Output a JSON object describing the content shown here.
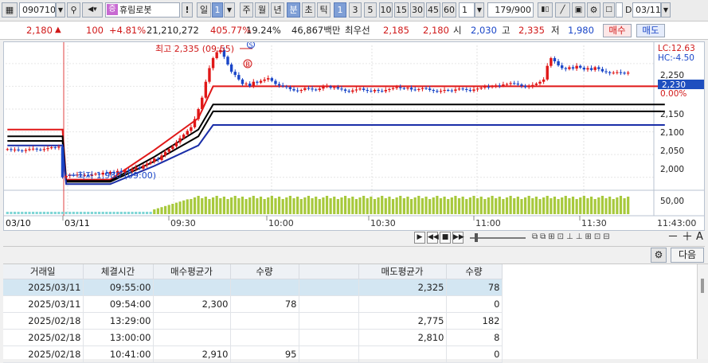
{
  "toolbar": {
    "stock_code": "090710",
    "stock_name": "휴림로봇",
    "exclaim": "!",
    "period_tabs": [
      "일",
      "1",
      "주",
      "월",
      "년",
      "분",
      "초",
      "틱"
    ],
    "active_period": "분",
    "intervals": [
      "1",
      "3",
      "5",
      "10",
      "15",
      "30",
      "45",
      "60"
    ],
    "active_interval": "1",
    "unit_value": "1",
    "count": "179/900",
    "checkbox_label": "D",
    "date": "03/11"
  },
  "quote": {
    "price": "2,180",
    "change": "100",
    "change_pct": "+4.81%",
    "volume": "21,210,272",
    "vol_ratio": "405.77%",
    "turnover": "19.24%",
    "amount": "46,867백만",
    "best_ask_label": "최우선",
    "best_ask": "2,185",
    "best_bid": "2,180",
    "open_label": "시",
    "open": "2,030",
    "high_label": "고",
    "high": "2,335",
    "low_label": "저",
    "low": "1,980",
    "buy_label": "매수",
    "sell_label": "매도"
  },
  "chart_data": {
    "type": "candlestick",
    "title": "",
    "x_tick_labels": [
      "03/10",
      "03/11",
      "09:30",
      "10:00",
      "10:30",
      "11:00",
      "11:30",
      "11:43:00"
    ],
    "y_tick_labels": [
      "2,250",
      "2,230",
      "0.00%",
      "2,150",
      "2,100",
      "2,050",
      "2,000"
    ],
    "volume_tick_label": "50,00",
    "ylim": [
      1975,
      2290
    ],
    "annotations": {
      "high": "최고 2,335 (09:55)",
      "low": "최저 1,980 (09:00)",
      "lc": "LC:12.63",
      "hc": "HC:-4.50",
      "marker_s": "S",
      "marker_b": "B"
    },
    "current_price_label": "2,230",
    "current_pct_label": "0.00%",
    "close_series": [
      2062,
      2060,
      2061,
      2059,
      2058,
      2060,
      2062,
      2063,
      2061,
      2060,
      2062,
      2064,
      2066,
      2065,
      2067,
      2000,
      2003,
      2005,
      2004,
      2006,
      2004,
      2005,
      2003,
      2006,
      2008,
      2006,
      2010,
      2008,
      2012,
      2009,
      2014,
      2011,
      2016,
      2013,
      2018,
      2022,
      2019,
      2026,
      2030,
      2034,
      2041,
      2038,
      2048,
      2056,
      2062,
      2068,
      2077,
      2086,
      2094,
      2102,
      2110,
      2128,
      2150,
      2175,
      2210,
      2240,
      2262,
      2275,
      2280,
      2265,
      2248,
      2232,
      2225,
      2215,
      2205,
      2206,
      2200,
      2210,
      2208,
      2212,
      2215,
      2218,
      2212,
      2205,
      2202,
      2200,
      2198,
      2194,
      2191,
      2190,
      2192,
      2196,
      2195,
      2193,
      2192,
      2195,
      2199,
      2200,
      2197,
      2198,
      2195,
      2193,
      2190,
      2188,
      2191,
      2193,
      2195,
      2192,
      2190,
      2189,
      2192,
      2190,
      2189,
      2192,
      2194,
      2196,
      2198,
      2196,
      2195,
      2197,
      2193,
      2192,
      2194,
      2196,
      2195,
      2192,
      2190,
      2188,
      2190,
      2192,
      2191,
      2190,
      2193,
      2195,
      2194,
      2192,
      2190,
      2193,
      2195,
      2197,
      2199,
      2198,
      2200,
      2202,
      2201,
      2204,
      2205,
      2207,
      2206,
      2204,
      2201,
      2198,
      2200,
      2203,
      2206,
      2210,
      2215,
      2245,
      2262,
      2255,
      2246,
      2240,
      2238,
      2242,
      2239,
      2245,
      2241,
      2237,
      2240,
      2236,
      2242,
      2238,
      2233,
      2231,
      2229,
      2230,
      2231,
      2230,
      2228,
      2230
    ],
    "ma_lines": [
      {
        "name": "",
        "color": "#e01818",
        "points": [
          [
            0,
            2105
          ],
          [
            15,
            2105
          ],
          [
            16,
            1995
          ],
          [
            28,
            1995
          ],
          [
            40,
            2060
          ],
          [
            52,
            2130
          ],
          [
            56,
            2200
          ],
          [
            60,
            2200
          ],
          [
            179,
            2200
          ]
        ]
      },
      {
        "name": "",
        "color": "#000000",
        "points": [
          [
            0,
            2090
          ],
          [
            15,
            2090
          ],
          [
            16,
            1992
          ],
          [
            28,
            1992
          ],
          [
            40,
            2045
          ],
          [
            52,
            2105
          ],
          [
            56,
            2160
          ],
          [
            60,
            2160
          ],
          [
            179,
            2160
          ]
        ]
      },
      {
        "name": "",
        "color": "#000000",
        "points": [
          [
            0,
            2080
          ],
          [
            15,
            2080
          ],
          [
            16,
            1990
          ],
          [
            28,
            1990
          ],
          [
            40,
            2035
          ],
          [
            52,
            2090
          ],
          [
            56,
            2145
          ],
          [
            60,
            2145
          ],
          [
            179,
            2145
          ]
        ]
      },
      {
        "name": "",
        "color": "#1a2ea8",
        "points": [
          [
            0,
            2070
          ],
          [
            15,
            2070
          ],
          [
            16,
            1985
          ],
          [
            28,
            1985
          ],
          [
            40,
            2025
          ],
          [
            52,
            2070
          ],
          [
            56,
            2115
          ],
          [
            60,
            2115
          ],
          [
            179,
            2115
          ]
        ]
      }
    ]
  },
  "navstrip": {
    "buttons": [
      "▶",
      "◀◀",
      "■",
      "▶▶"
    ],
    "right_buttons": [
      "－",
      "＋",
      "A"
    ]
  },
  "grid": {
    "gear_label": "⚙",
    "next_label": "다음",
    "columns": [
      "거래일",
      "체결시간",
      "매수평균가",
      "수량",
      "",
      "매도평균가",
      "수량"
    ],
    "rows": [
      [
        "2025/03/11",
        "09:55:00",
        "",
        "",
        "",
        "2,325",
        "78"
      ],
      [
        "2025/03/11",
        "09:54:00",
        "2,300",
        "78",
        "",
        "",
        "0"
      ],
      [
        "2025/02/18",
        "13:29:00",
        "",
        "",
        "",
        "2,775",
        "182"
      ],
      [
        "2025/02/18",
        "13:00:00",
        "",
        "",
        "",
        "2,810",
        "8"
      ],
      [
        "2025/02/18",
        "10:41:00",
        "2,910",
        "95",
        "",
        "",
        "0"
      ]
    ]
  }
}
